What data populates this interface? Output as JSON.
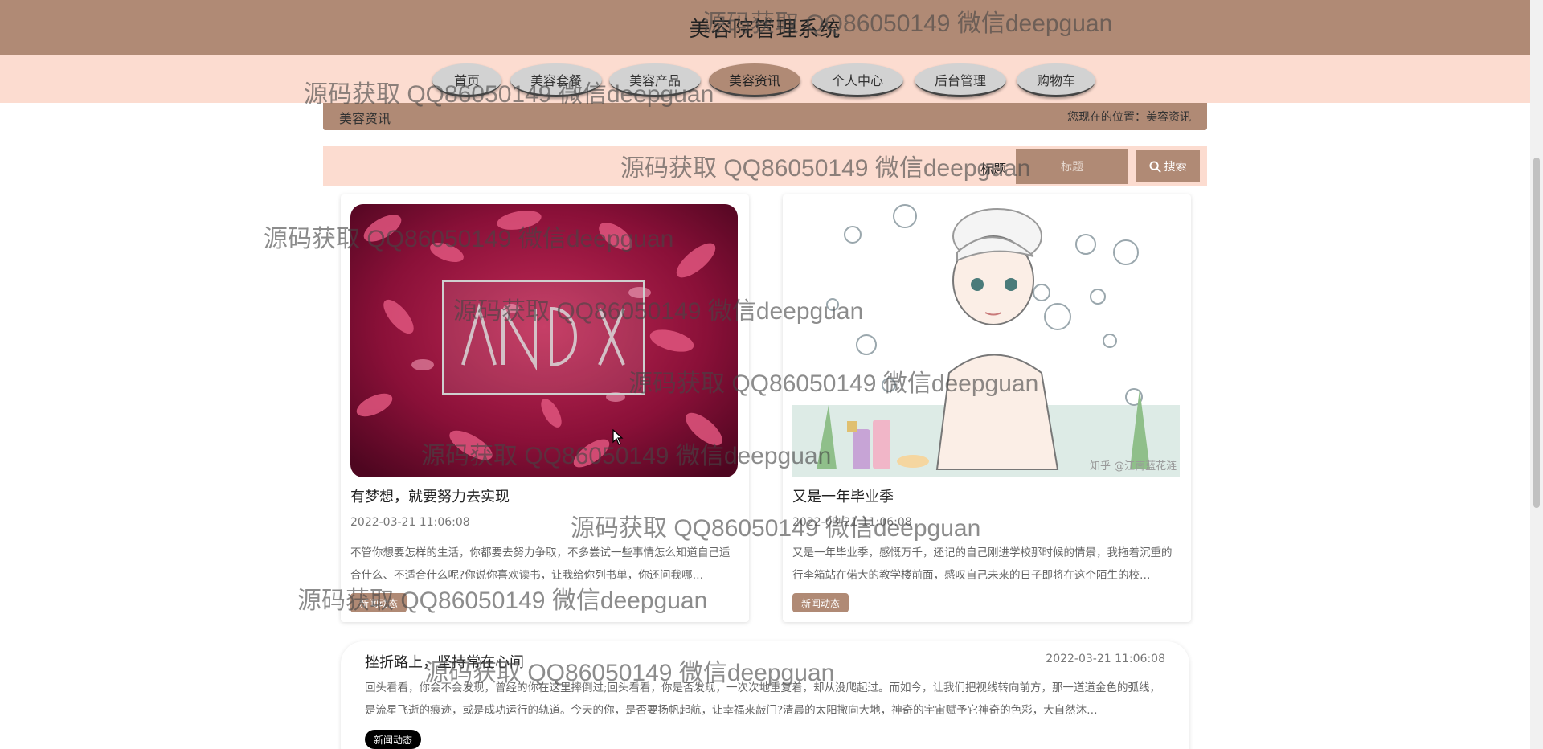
{
  "header": {
    "site_title": "美容院管理系统"
  },
  "nav": {
    "items": [
      {
        "label": "首页"
      },
      {
        "label": "美容套餐"
      },
      {
        "label": "美容产品"
      },
      {
        "label": "美容资讯",
        "active": true
      },
      {
        "label": "个人中心"
      },
      {
        "label": "后台管理"
      },
      {
        "label": "购物车"
      }
    ]
  },
  "breadcrumb": {
    "title": "美容资讯",
    "location_prefix": "您现在的位置：",
    "location": "美容资讯"
  },
  "search": {
    "label": "标题",
    "placeholder": "标题",
    "button_label": "搜索",
    "button_icon": "search-icon"
  },
  "cards": [
    {
      "title": "有梦想，就要努力去实现",
      "time": "2022-03-21 11:06:08",
      "desc": "不管你想要怎样的生活，你都要去努力争取，不多尝试一些事情怎么知道自己适合什么、不适合什么呢?你说你喜欢读书，让我给你列书单，你还问我哪…",
      "tag": "新闻动态"
    },
    {
      "title": "又是一年毕业季",
      "time": "2022-03-21 11:06:08",
      "desc": "又是一年毕业季，感慨万千，还记的自己刚进学校那时候的情景，我拖着沉重的行李箱站在偌大的教学楼前面，感叹自己未来的日子即将在这个陌生的校…",
      "tag": "新闻动态",
      "image_caption": "知乎 @江南蓝花涟"
    }
  ],
  "list_items": [
    {
      "title": "挫折路上，坚持常在心间",
      "time": "2022-03-21 11:06:08",
      "desc": "回头看看，你会不会发现，曾经的你在这里摔倒过;回头看看，你是否发现，一次次地重复着，却从没爬起过。而如今，让我们把视线转向前方，那一道道金色的弧线，是流星飞逝的痕迹，或是成功运行的轨道。今天的你，是否要扬帆起航，让幸福来敲门?清晨的太阳撒向大地，神奇的宇宙赋予它神奇的色彩，大自然沐…",
      "tag": "新闻动态"
    }
  ],
  "watermark": "源码获取 QQ86050149 微信deepguan",
  "colors": {
    "header": "#b08a75",
    "nav_bg": "#fcdcd0",
    "accent": "#b08a75"
  }
}
